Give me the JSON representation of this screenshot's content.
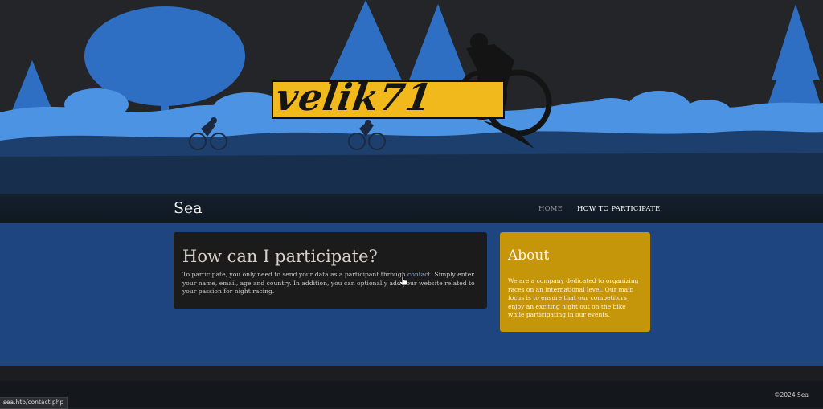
{
  "header": {
    "logo_text": "velik71"
  },
  "navbar": {
    "site_name": "Sea",
    "items": [
      {
        "label": "HOME"
      },
      {
        "label": "HOW TO PARTICIPATE"
      }
    ]
  },
  "post": {
    "title": "How can I participate?",
    "body_before_link": "To participate, you only need to send your data as a participant through ",
    "link_text": "contact",
    "body_after_link": ". Simply enter your name, email, age and country. In addition, you can optionally add your website related to your passion for night racing."
  },
  "about": {
    "title": "About",
    "body": "We are a company dedicated to organizing races on an international level. Our main focus is to ensure that our competitors enjoy an exciting night out on the bike while participating in our events."
  },
  "footer": {
    "copyright": "©2024 Sea"
  },
  "status_bar": {
    "url": "sea.htb/contact.php"
  },
  "colors": {
    "banner_bg": "#232528",
    "tree_blue": "#3b82d6",
    "logo_yellow": "#f2b91d",
    "main_bg": "#1e4580",
    "post_bg": "#1b1b1b",
    "about_bg": "#c5950a",
    "link": "#8aaee3"
  }
}
